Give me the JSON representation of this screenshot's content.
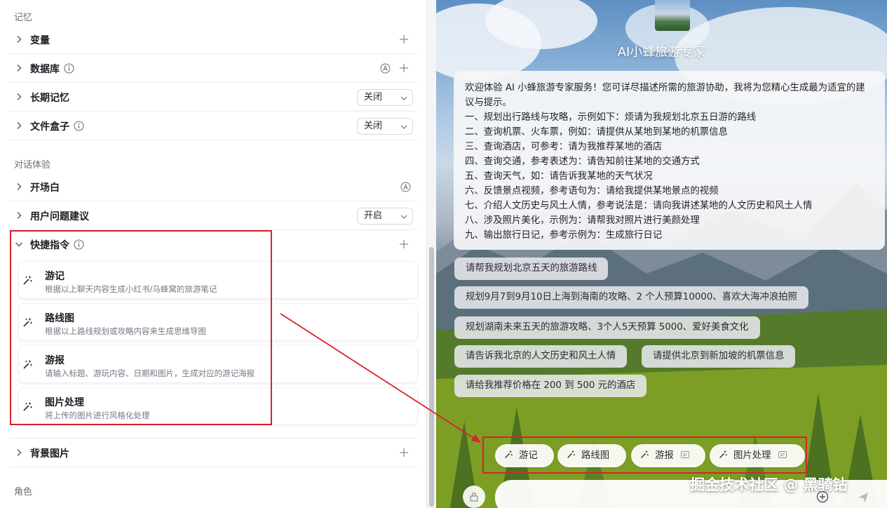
{
  "left": {
    "sections": {
      "memory": "记忆",
      "dialog": "对话体验",
      "role": "角色"
    },
    "rows": {
      "variables": "变量",
      "database": "数据库",
      "long_memory": "长期记忆",
      "file_box": "文件盒子",
      "opening": "开场白",
      "suggestions": "用户问题建议",
      "shortcuts": "快捷指令",
      "background": "背景图片"
    },
    "selects": {
      "long_memory": "关闭",
      "file_box": "关闭",
      "suggestions": "开启"
    },
    "shortcuts": [
      {
        "title": "游记",
        "desc": "根据以上聊天内容生成小红书/马蜂窝的旅游笔记"
      },
      {
        "title": "路线图",
        "desc": "根据以上路线规划或攻略内容来生成思维导图"
      },
      {
        "title": "游报",
        "desc": "请输入标题、游玩内容、日期和图片，生成对应的游记海报"
      },
      {
        "title": "图片处理",
        "desc": "将上传的图片进行风格化处理"
      }
    ]
  },
  "preview": {
    "bot_name": "AI小蜂旅游专家",
    "welcome_lines": [
      "欢迎体验 AI 小蜂旅游专家服务！您可详尽描述所需的旅游协助，我将为您精心生成最为适宜的建议与提示。",
      "一、规划出行路线与攻略，示例如下：烦请为我规划北京五日游的路线",
      "二、查询机票、火车票，例如：请提供从某地到某地的机票信息",
      "三、查询酒店，可参考：请为我推荐某地的酒店",
      "四、查询交通，参考表述为：请告知前往某地的交通方式",
      "五、查询天气，如：请告诉我某地的天气状况",
      "六、反馈景点视频，参考语句为：请给我提供某地景点的视频",
      "七、介绍人文历史与风土人情，参考说法是：请向我讲述某地的人文历史和风土人情",
      "八、涉及照片美化，示例为：请帮我对照片进行美颜处理",
      "九、输出旅行日记，参考示例为：生成旅行日记"
    ],
    "suggestions": [
      "请帮我规划北京五天的旅游路线",
      "规划9月7到9月10日上海到海南的攻略、2 个人预算10000、喜欢大海冲浪拍照",
      "规划湖南未来五天的旅游攻略、3个人5天预算 5000、爱好美食文化",
      "请告诉我北京的人文历史和风土人情",
      "请提供北京到新加坡的机票信息",
      "请给我推荐价格在 200 到 500 元的酒店"
    ],
    "shortcut_pills": [
      "游记",
      "路线图",
      "游报",
      "图片处理"
    ],
    "watermark": "掘金技术社区 @ 黑骑钻"
  },
  "colors": {
    "annotation_red": "#d8232a",
    "panel_border": "#ececf0"
  },
  "icons": [
    "chevron-right-icon",
    "chevron-down-icon",
    "info-icon",
    "plus-icon",
    "auto-icon",
    "caret-down-icon",
    "magic-wand-icon",
    "form-icon",
    "clear-context-icon",
    "add-circle-icon",
    "send-icon"
  ]
}
